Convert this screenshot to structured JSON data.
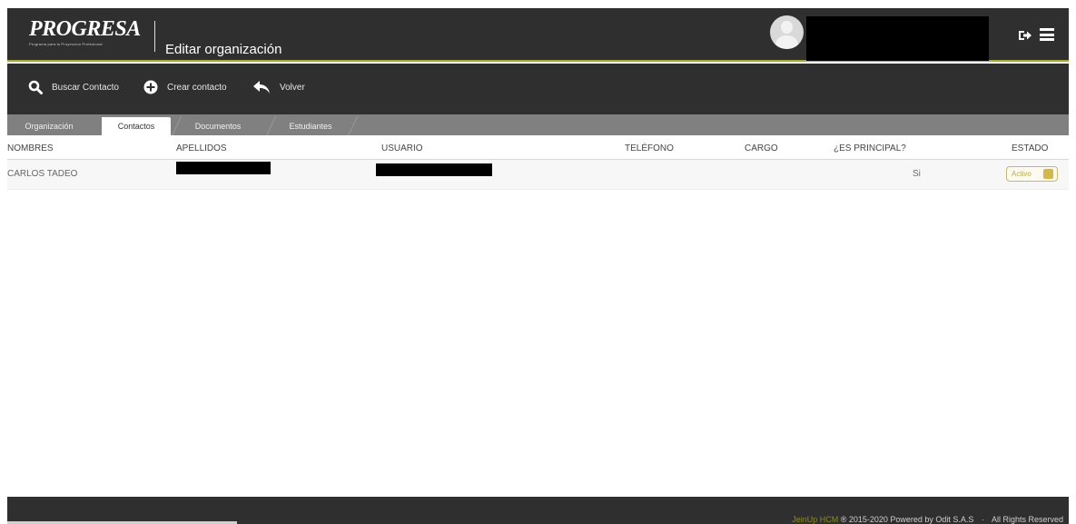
{
  "header": {
    "logo_text": "PROGRESA",
    "logo_tagline": "Programa para la Proyección Profesional",
    "page_title": "Editar organización",
    "user_name": ""
  },
  "toolbar": {
    "search_label": "Buscar Contacto",
    "create_label": "Crear contacto",
    "back_label": "Volver"
  },
  "tabs": [
    {
      "label": "Organización"
    },
    {
      "label": "Contactos"
    },
    {
      "label": "Documentos"
    },
    {
      "label": "Estudiantes"
    }
  ],
  "table": {
    "columns": [
      "NOMBRES",
      "APELLIDOS",
      "USUARIO",
      "TELÉFONO",
      "CARGO",
      "¿ES PRINCIPAL?",
      "ESTADO"
    ],
    "rows": [
      {
        "nombres": "CARLOS TADEO",
        "apellidos": "",
        "usuario": "",
        "telefono": "",
        "cargo": "",
        "principal": "Si",
        "estado": "Activo"
      }
    ]
  },
  "footer": {
    "brand": "JeinUp HCM",
    "copyright": "® 2015-2020 Powered by Odit S.A.S",
    "sep": "·",
    "rights": "All Rights Reserved"
  },
  "colors": {
    "header_bg": "#2f2f2f",
    "accent_line": "#a8b020",
    "tab_bg": "#808080",
    "status_badge": "#c7b86a"
  }
}
